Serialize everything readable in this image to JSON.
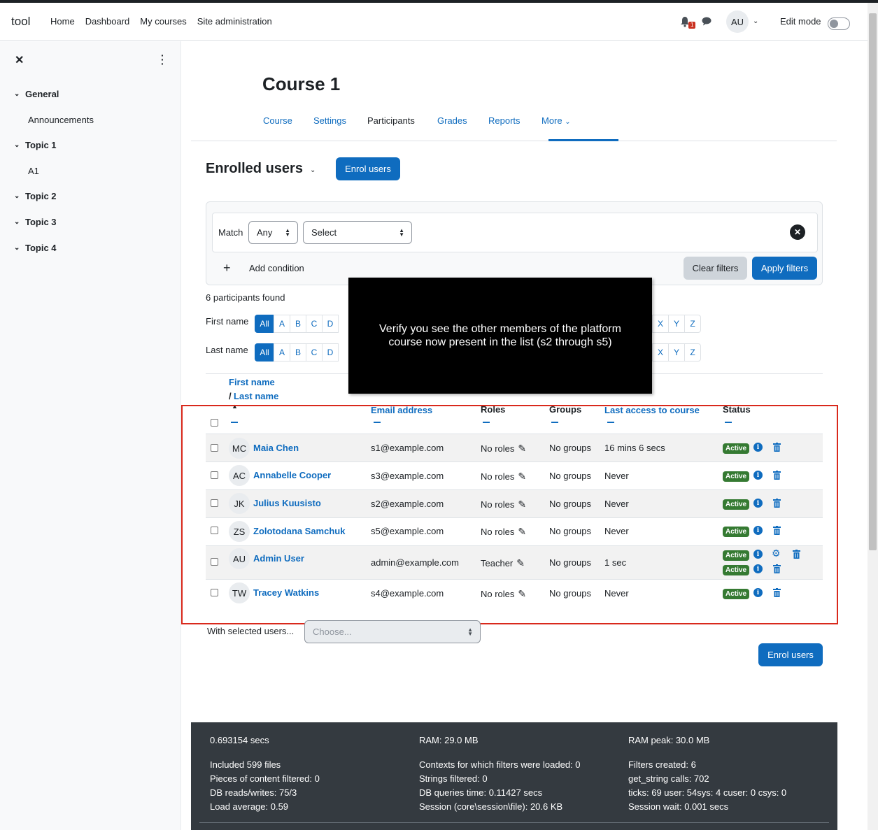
{
  "navbar": {
    "brand": "tool",
    "links": [
      "Home",
      "Dashboard",
      "My courses",
      "Site administration"
    ],
    "notification_count": "1",
    "user_initials": "AU",
    "edit_mode_label": "Edit mode"
  },
  "drawer": {
    "items": [
      {
        "label": "General",
        "type": "section"
      },
      {
        "label": "Announcements",
        "type": "sub"
      },
      {
        "label": "Topic 1",
        "type": "section"
      },
      {
        "label": "A1",
        "type": "sub"
      },
      {
        "label": "Topic 2",
        "type": "section"
      },
      {
        "label": "Topic 3",
        "type": "section"
      },
      {
        "label": "Topic 4",
        "type": "section"
      }
    ]
  },
  "course": {
    "title": "Course 1",
    "tabs": [
      "Course",
      "Settings",
      "Participants",
      "Grades",
      "Reports",
      "More"
    ],
    "active_tab": "Participants"
  },
  "participants": {
    "heading": "Enrolled users",
    "enrol_button": "Enrol users",
    "filter": {
      "match_label": "Match",
      "match_value": "Any",
      "select_value": "Select",
      "add_condition": "Add condition",
      "clear_label": "Clear filters",
      "apply_label": "Apply filters"
    },
    "found_text": "6 participants found",
    "first_name_label": "First name",
    "last_name_label": "Last name",
    "initials_visible": [
      "All",
      "A",
      "B",
      "C",
      "D"
    ],
    "initials_tail": [
      "X",
      "Y",
      "Z"
    ],
    "columns": {
      "first_name": "First name",
      "last_name": "Last name",
      "email": "Email address",
      "roles": "Roles",
      "groups": "Groups",
      "last_access": "Last access to course",
      "status": "Status"
    },
    "rows": [
      {
        "initials": "MC",
        "name": "Maia Chen",
        "email": "s1@example.com",
        "roles": "No roles",
        "groups": "No groups",
        "last_access": "16 mins 6 secs",
        "status": "Active"
      },
      {
        "initials": "AC",
        "name": "Annabelle Cooper",
        "email": "s3@example.com",
        "roles": "No roles",
        "groups": "No groups",
        "last_access": "Never",
        "status": "Active"
      },
      {
        "initials": "JK",
        "name": "Julius Kuusisto",
        "email": "s2@example.com",
        "roles": "No roles",
        "groups": "No groups",
        "last_access": "Never",
        "status": "Active"
      },
      {
        "initials": "ZS",
        "name": "Zolotodana Samchuk",
        "email": "s5@example.com",
        "roles": "No roles",
        "groups": "No groups",
        "last_access": "Never",
        "status": "Active"
      },
      {
        "initials": "AU",
        "name": "Admin User",
        "email": "admin@example.com",
        "roles": "Teacher",
        "groups": "No groups",
        "last_access": "1 sec",
        "status": "Active",
        "status2": "Active"
      },
      {
        "initials": "TW",
        "name": "Tracey Watkins",
        "email": "s4@example.com",
        "roles": "No roles",
        "groups": "No groups",
        "last_access": "Never",
        "status": "Active"
      }
    ],
    "with_selected_label": "With selected users...",
    "choose_placeholder": "Choose..."
  },
  "tooltip": {
    "text": "Verify you see the other members of the platform course now present in the list (s2 through s5)"
  },
  "footer": {
    "col1": [
      "0.693154 secs",
      "Included 599 files",
      "Pieces of content filtered: 0",
      "DB reads/writes: 75/3",
      "Load average: 0.59"
    ],
    "col2": [
      "RAM: 29.0 MB",
      "Contexts for which filters were loaded: 0",
      "Strings filtered: 0",
      "DB queries time: 0.11427 secs",
      "Session (core\\session\\file): 20.6 KB"
    ],
    "col3": [
      "RAM peak: 30.0 MB",
      "Filters created: 6",
      "get_string calls: 702",
      "ticks: 69 user: 54sys: 4 cuser: 0 csys: 0",
      "Session wait: 0.001 secs"
    ]
  },
  "colors": {
    "primary": "#0f6cbf",
    "active_badge": "#357a32",
    "highlight_border": "#d9291c"
  }
}
